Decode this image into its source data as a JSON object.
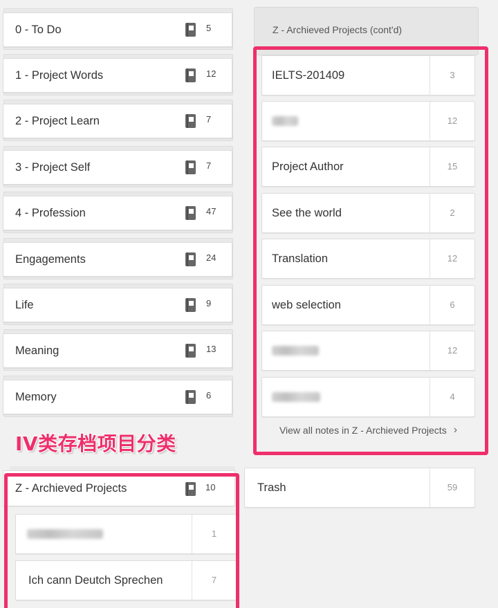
{
  "left_notebooks": [
    {
      "name": "0 - To Do",
      "count": "5",
      "icon": "notebook-icon"
    },
    {
      "name": "1 - Project Words",
      "count": "12",
      "icon": "notebook-icon"
    },
    {
      "name": "2 - Project Learn",
      "count": "7",
      "icon": "notebook-icon"
    },
    {
      "name": "3 - Project Self",
      "count": "7",
      "icon": "notebook-icon"
    },
    {
      "name": "4 - Profession",
      "count": "47",
      "icon": "notebook-icon"
    },
    {
      "name": "Engagements",
      "count": "24",
      "icon": "notebook-icon"
    },
    {
      "name": "Life",
      "count": "9",
      "icon": "notebook-icon"
    },
    {
      "name": "Meaning",
      "count": "13",
      "icon": "notebook-icon"
    },
    {
      "name": "Memory",
      "count": "6",
      "icon": "notebook-icon"
    }
  ],
  "archive_stack": {
    "header": "Z - Archieved Projects (cont'd)",
    "items": [
      {
        "name": "IELTS-201409",
        "count": "3"
      },
      {
        "name": "",
        "count": "12"
      },
      {
        "name": "Project Author",
        "count": "15"
      },
      {
        "name": "See the world",
        "count": "2"
      },
      {
        "name": "Translation",
        "count": "12"
      },
      {
        "name": "web selection",
        "count": "6"
      },
      {
        "name": "",
        "count": "12"
      },
      {
        "name": "",
        "count": "4"
      }
    ],
    "view_all": "View all notes in Z - Archieved Projects",
    "view_all_icon": "chevron-right-icon"
  },
  "annotation": "IV类存档项目分类",
  "bottom_stack": {
    "name": "Z - Archieved Projects",
    "count": "10",
    "icon": "notebook-icon",
    "items": [
      {
        "name": "",
        "count": "1"
      },
      {
        "name": "Ich cann Deutch Sprechen",
        "count": "7"
      }
    ]
  },
  "trash": {
    "name": "Trash",
    "count": "59"
  },
  "colors": {
    "highlight": "#ee2f6c",
    "background": "#f1f1f1",
    "card": "#ffffff"
  }
}
